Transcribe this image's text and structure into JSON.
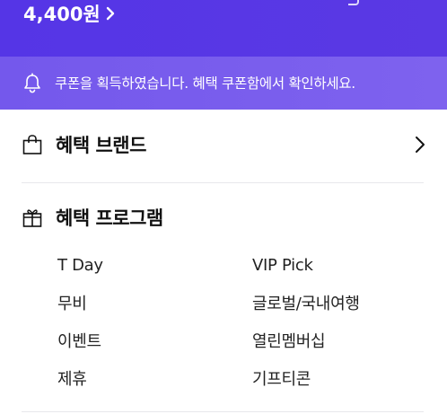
{
  "hero": {
    "amount": "4,400원"
  },
  "notice": {
    "icon": "bell-icon",
    "message": "쿠폰을 획득하였습니다. 혜택 쿠폰함에서 확인하세요."
  },
  "sections": {
    "brand": {
      "title": "혜택 브랜드",
      "icon": "shopping-bag-icon"
    },
    "program": {
      "title": "혜택 프로그램",
      "icon": "gift-icon"
    }
  },
  "program_items": {
    "0": "T Day",
    "1": "VIP Pick",
    "2": "무비",
    "3": "글로벌/국내여행",
    "4": "이벤트",
    "5": "열린멤버십",
    "6": "제휴",
    "7": "기프티콘"
  },
  "colors": {
    "hero_bg": "#5535e6",
    "notice_bg": "#7a5eed",
    "text": "#111111",
    "divider": "#e8e8ec"
  }
}
